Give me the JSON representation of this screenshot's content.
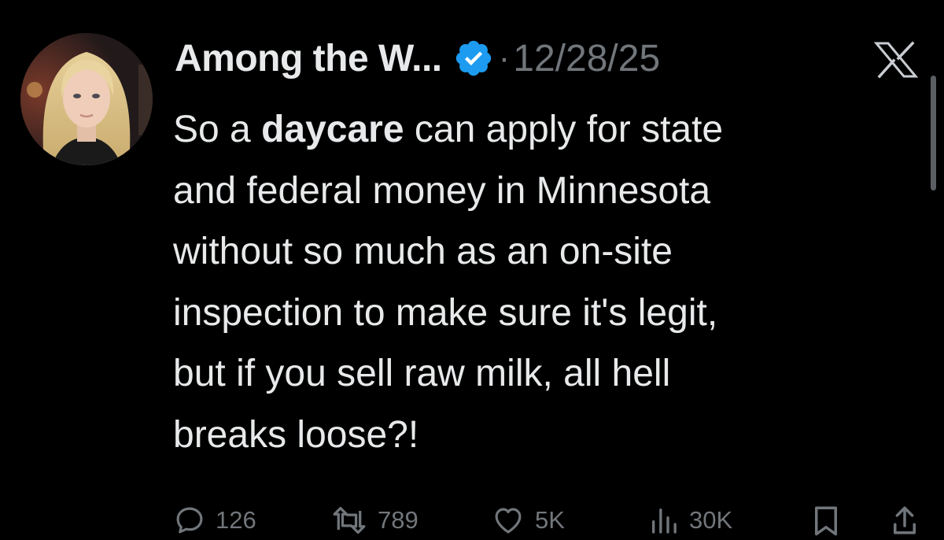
{
  "tweet": {
    "display_name": "Among the W...",
    "separator": "·",
    "date": "12/28/25",
    "body_lines": {
      "l1_prefix": "So a ",
      "l1_bold": "daycare",
      "l1_suffix": " can apply for state",
      "l2": "and federal money in Minnesota",
      "l3": "without so much as an on-site",
      "l4": "inspection to make sure it's legit,",
      "l5": "but if you sell raw milk, all hell",
      "l6": "breaks loose?!"
    },
    "metrics": {
      "replies": "126",
      "reposts": "789",
      "likes": "5K",
      "views": "30K"
    }
  },
  "icons": {
    "verified": "verified-badge-icon",
    "platform": "x-logo-icon",
    "reply": "reply-icon",
    "repost": "repost-icon",
    "like": "heart-icon",
    "views": "views-icon",
    "bookmark": "bookmark-icon",
    "share": "share-icon"
  },
  "colors": {
    "background": "#000000",
    "text": "#e7e9ea",
    "muted": "#71767b",
    "verified": "#1d9bf0"
  }
}
